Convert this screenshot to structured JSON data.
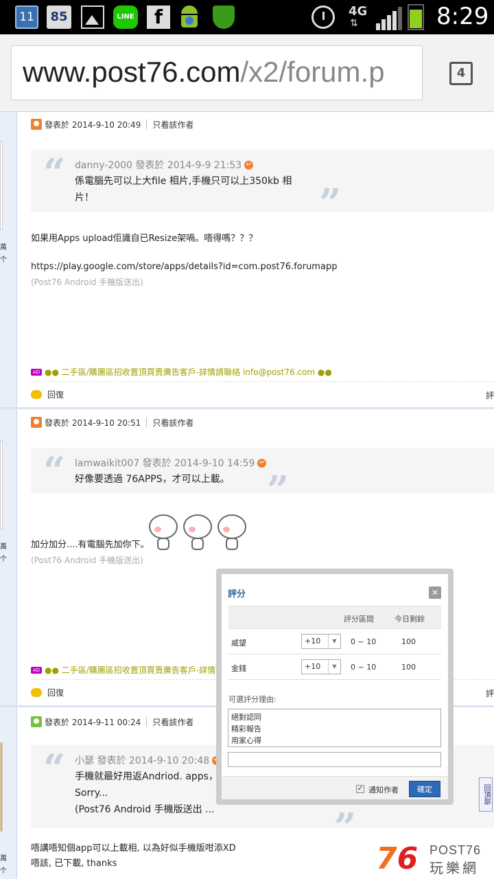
{
  "status_bar": {
    "calendar_day": "11",
    "badge_number": "85",
    "line_label": "LINE",
    "facebook_label": "f",
    "network": "4G",
    "time": "8:29"
  },
  "browser": {
    "url_domain": "www.post76.com",
    "url_path": "/x2/forum.p",
    "tab_count": "4"
  },
  "common": {
    "only_author": "只看該作者",
    "reply": "回復",
    "rate_cut": "評",
    "sent_from": "(Post76 Android 手機版送出)",
    "ad_icon": "AD",
    "back_to_top": "回頂部"
  },
  "posts": [
    {
      "posted": "發表於 2014-9-10 20:49",
      "quote_author": "danny-2000 發表於 2014-9-9 21:53",
      "quote_line1": "係電腦先可以上大file 相片,手機只可以上350kb 相",
      "quote_line2": "片！",
      "text1": "如果用Apps upload佢識自已Resize架喎。唔得嗎？？？",
      "text2": "https://play.google.com/store/apps/details?id=com.post76.forumapp",
      "ad": "●● 二手區/購團區招收置頂買賣廣告客戶-詳情請聯絡 info@post76.com ●●"
    },
    {
      "posted": "發表於 2014-9-10 20:51",
      "quote_author": "lamwaikit007 發表於 2014-9-10 14:59",
      "quote_line1": "好像要透過 76APPS，才可以上載。",
      "text1": "加分加分....有電腦先加你下。",
      "ad": "●● 二手區/購團區招收置頂買賣廣告客戶-詳情請聯絡"
    },
    {
      "posted": "發表於 2014-9-11 00:24",
      "quote_author": "小瑟 發表於 2014-9-10 20:48",
      "quote_line1": "手機就最好用返Andriod. apps，iF",
      "quote_line2": "Sorry...",
      "quote_line3": "(Post76 Android 手機版送出 ...",
      "text1": "唔講唔知個app可以上載相, 以為好似手機版咁添XD",
      "text2": "唔該, 已下載, thanks"
    }
  ],
  "left_meta": [
    "萬",
    "个"
  ],
  "rating_dialog": {
    "title": "評分",
    "close": "✕",
    "col_range": "評分區間",
    "col_remaining": "今日剩餘",
    "rows": [
      {
        "label": "威望",
        "value": "+10",
        "range": "0 ~ 10",
        "remaining": "100"
      },
      {
        "label": "金錢",
        "value": "+10",
        "range": "0 ~ 10",
        "remaining": "100"
      }
    ],
    "reason_label": "可選評分理由:",
    "reasons": [
      "絕對認同",
      "精彩報告",
      "用家心得"
    ],
    "notify_label": "通知作者",
    "confirm": "確定"
  },
  "logo": {
    "seven": "7",
    "six": "6",
    "post": "POST76",
    "cn": "玩樂網"
  }
}
